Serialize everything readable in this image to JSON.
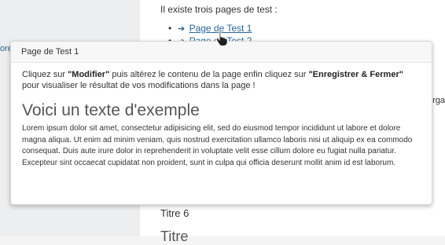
{
  "sidebar": {
    "fragment": "ore"
  },
  "main": {
    "intro_text": "Il existe trois pages de test :",
    "pages": [
      {
        "arrow": "➔",
        "label": "Page de Test 1"
      },
      {
        "arrow": "➔",
        "label": "Page de Test 2"
      }
    ],
    "right_fragment": "orga",
    "heading_titre6": "Titre 6",
    "heading_partial": "Titre"
  },
  "popup": {
    "title": "Page de Test 1",
    "instr_1": "Cliquez sur ",
    "instr_bold_1": "\"Modifier\"",
    "instr_2": " puis altérez le contenu de la page enfin cliquez sur ",
    "instr_bold_2": "\"Enregistrer & Fermer\"",
    "instr_3": " pour visualiser le résultat de vos modifications dans la page !",
    "example_heading": "Voici un texte d'exemple",
    "lorem": "Lorem ipsum dolor sit amet, consectetur adipisicing elit, sed do eiusmod tempor incididunt ut labore et dolore magna aliqua. Ut enim ad minim veniam, quis nostrud exercitation ullamco laboris nisi ut aliquip ex ea commodo consequat. Duis aute irure dolor in reprehenderit in voluptate velit esse cillum dolore eu fugiat nulla pariatur. Excepteur sint occaecat cupidatat non proident, sunt in culpa qui officia deserunt mollit anim id est laborum."
  },
  "icons": {
    "cursor": "hand-pointer-icon",
    "arrow": "arrow-right-icon"
  },
  "colors": {
    "link": "#2a6496",
    "popup_header_bg": "#f7f7f7"
  }
}
